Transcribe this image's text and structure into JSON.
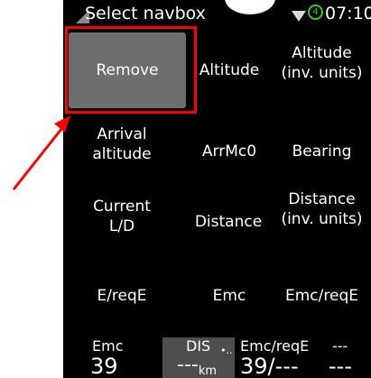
{
  "statusbar": {
    "title": "Select navbox",
    "gps_count": "4",
    "time": "07:10"
  },
  "grid": [
    {
      "label": "Remove",
      "selected": true
    },
    {
      "label": "Altitude"
    },
    {
      "label": "Altitude\n(inv. units)"
    },
    {
      "label": "Arrival\naltitude"
    },
    {
      "label": "ArrMc0"
    },
    {
      "label": "Bearing"
    },
    {
      "label": "Current\nL/D"
    },
    {
      "label": "Distance"
    },
    {
      "label": "Distance\n(inv. units)"
    },
    {
      "label": "E/reqE"
    },
    {
      "label": "Emc"
    },
    {
      "label": "Emc/reqE"
    }
  ],
  "bottom_bar": [
    {
      "label": "Emc",
      "value": "39"
    },
    {
      "label": "DIS",
      "value": "---",
      "unit": "km"
    },
    {
      "label": "Emc/reqE",
      "value": "39/---"
    },
    {
      "label": "---",
      "value": "---"
    }
  ],
  "colors": {
    "screen_bg": "#000000",
    "selected_cell": "#6e6e6e",
    "annotation": "#ff0000",
    "gps": "#2fd11a"
  }
}
